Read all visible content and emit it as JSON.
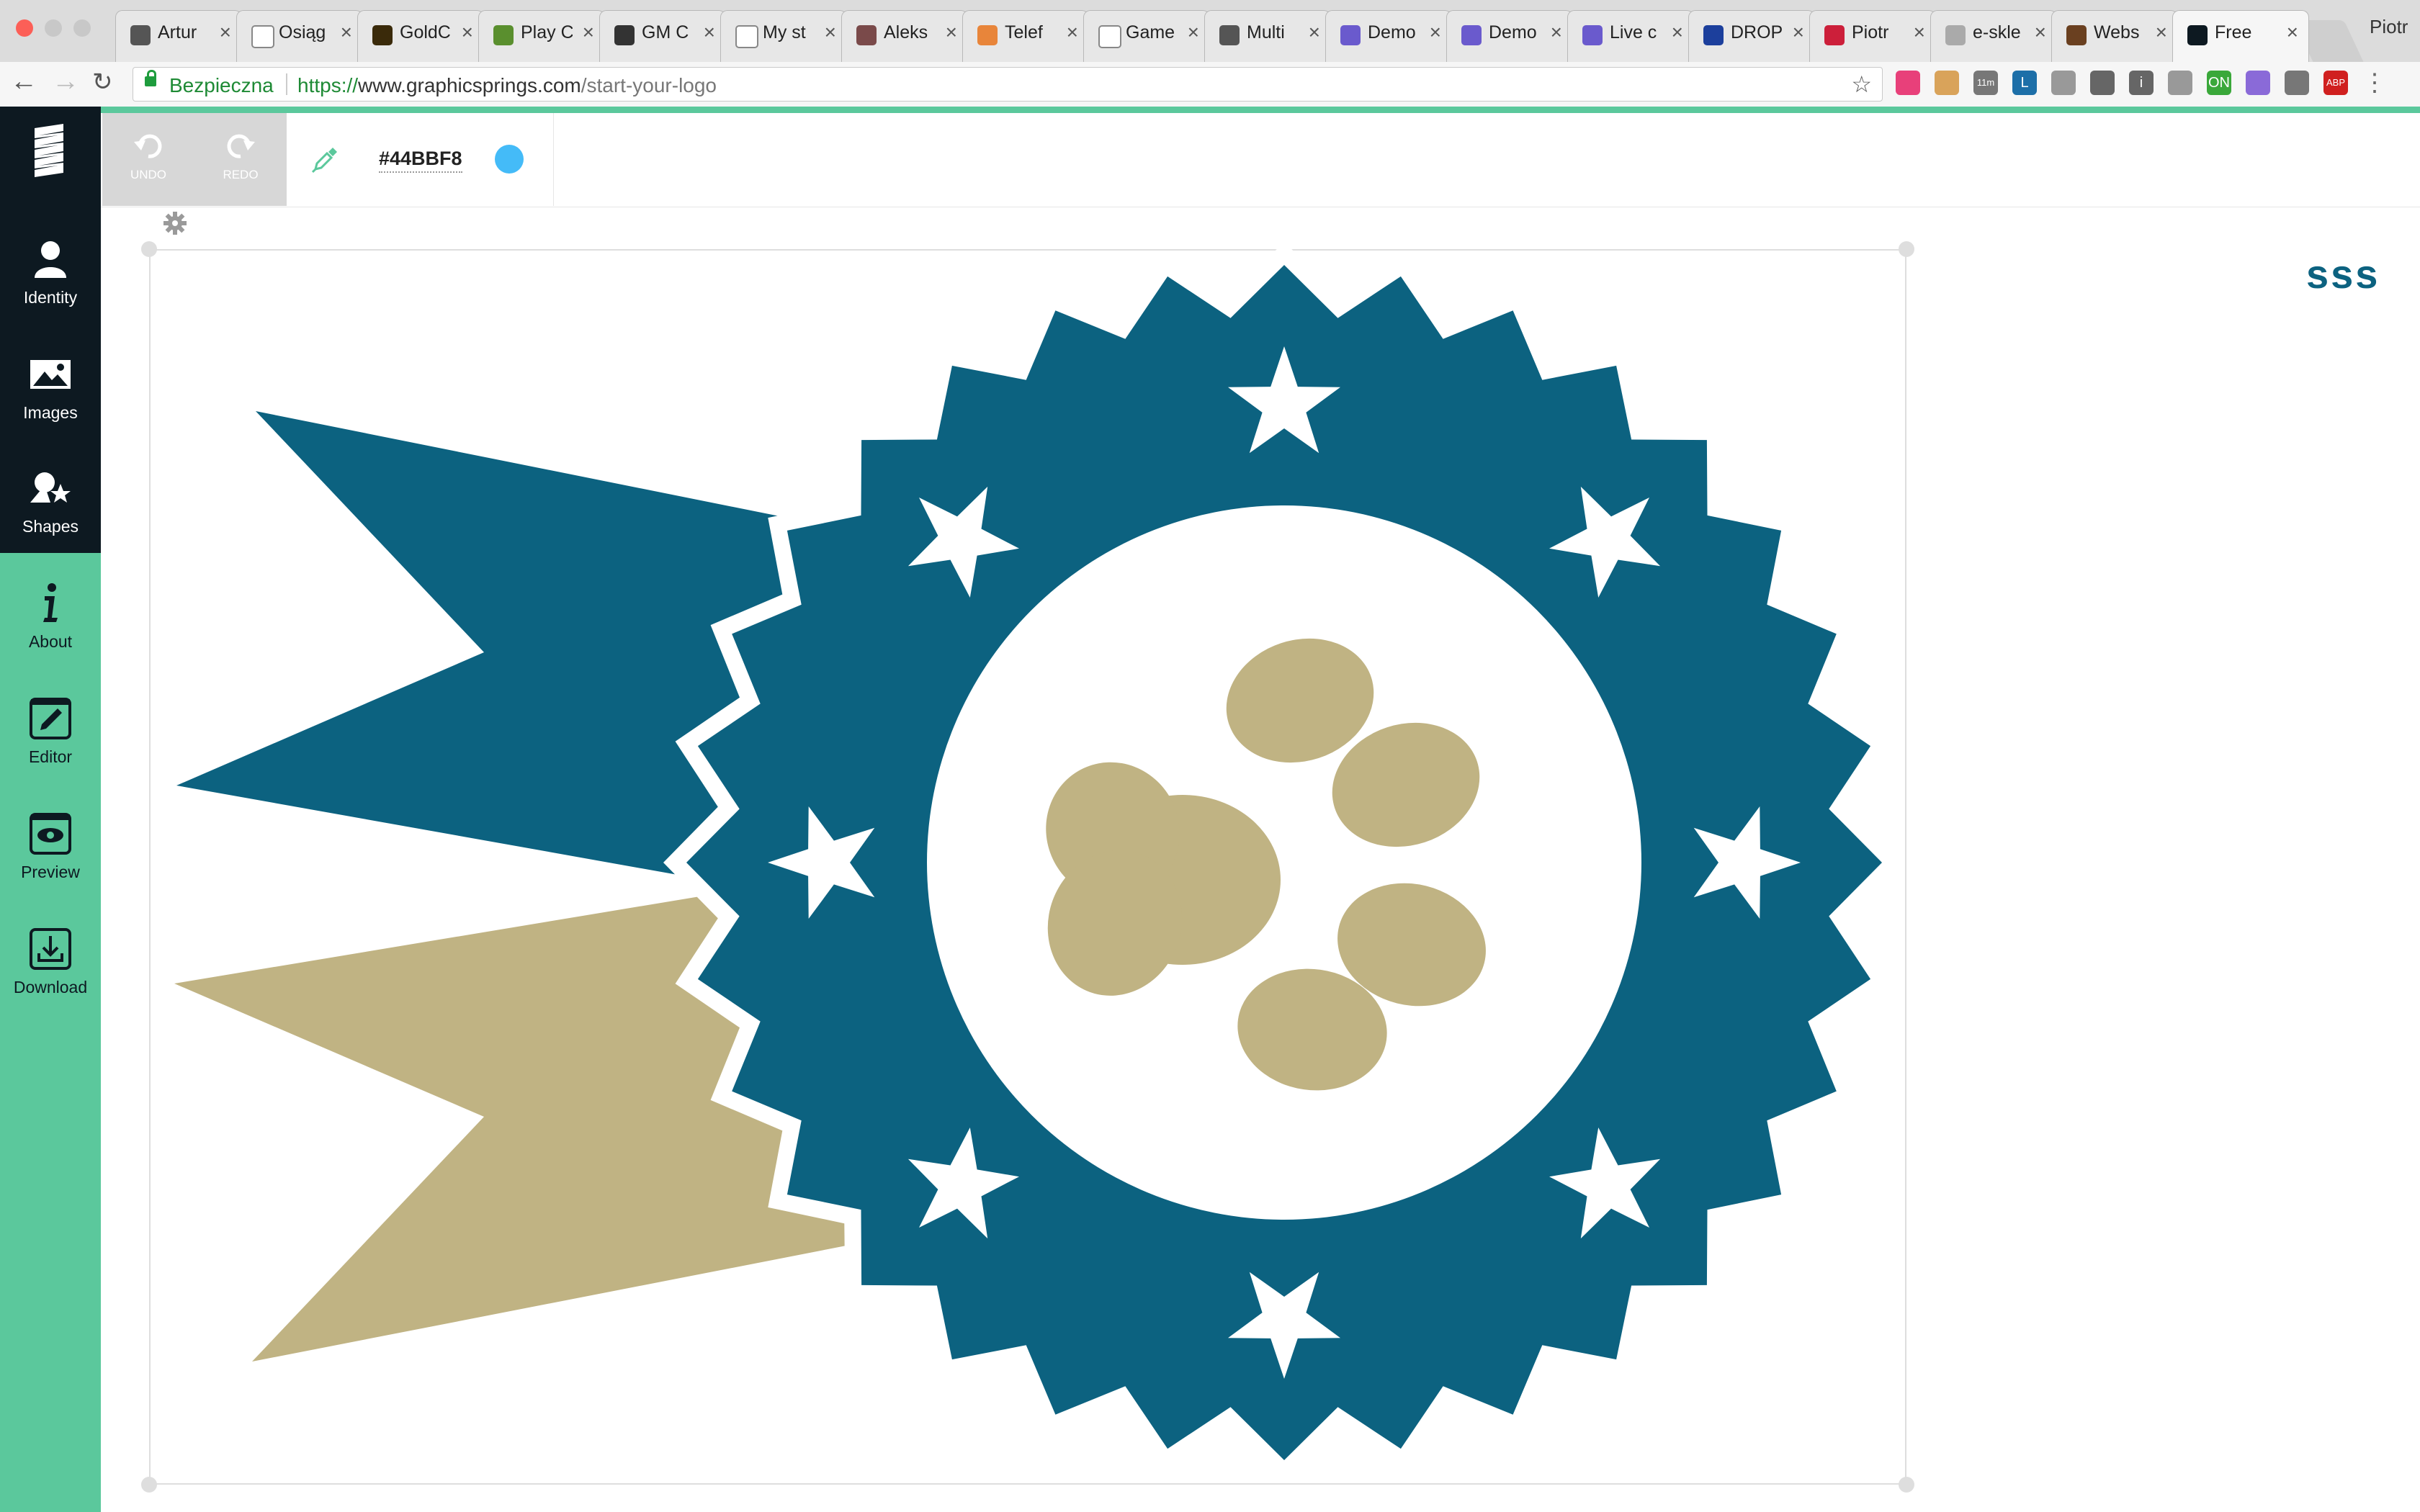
{
  "browser": {
    "tabs": [
      {
        "title": "Artur",
        "favicon": "shield-crest-icon",
        "color": "#555555"
      },
      {
        "title": "Osiąg",
        "favicon": "page-icon",
        "color": "#ffffff"
      },
      {
        "title": "GoldC",
        "favicon": "chess-icon",
        "color": "#3a2a0a"
      },
      {
        "title": "Play C",
        "favicon": "pawn-icon",
        "color": "#5a8f2e"
      },
      {
        "title": "GM C",
        "favicon": "gm-icon",
        "color": "#333333"
      },
      {
        "title": "My st",
        "favicon": "page-icon",
        "color": "#ffffff"
      },
      {
        "title": "Aleks",
        "favicon": "chess-pieces-icon",
        "color": "#7a4a4a"
      },
      {
        "title": "Telef",
        "favicon": "globe-icon",
        "color": "#e8853a"
      },
      {
        "title": "Game",
        "favicon": "page-icon",
        "color": "#ffffff"
      },
      {
        "title": "Multi",
        "favicon": "wordpress-icon",
        "color": "#555555"
      },
      {
        "title": "Demo",
        "favicon": "demo-icon",
        "color": "#6a5acd"
      },
      {
        "title": "Demo",
        "favicon": "demo-icon",
        "color": "#6a5acd"
      },
      {
        "title": "Live c",
        "favicon": "demo-icon",
        "color": "#6a5acd"
      },
      {
        "title": "DROP",
        "favicon": "eu-flag-icon",
        "color": "#1c3f9c"
      },
      {
        "title": "Piotr",
        "favicon": "eagle-icon",
        "color": "#cc1f3a"
      },
      {
        "title": "e-skle",
        "favicon": "shop-icon",
        "color": "#aaaaaa"
      },
      {
        "title": "Webs",
        "favicon": "portrait-icon",
        "color": "#6a4020"
      },
      {
        "title": "Free",
        "favicon": "graphicsprings-icon",
        "color": "#0d1921",
        "active": true
      }
    ],
    "tab_close": "×",
    "profile_name": "Piotr",
    "secure_label": "Bezpieczna",
    "url_protocol": "https://",
    "url_host": "www.graphicsprings.com",
    "url_path": "/start-your-logo",
    "extensions": [
      {
        "name": "stairs-extension-icon",
        "color": "#e8407a",
        "text": ""
      },
      {
        "name": "hammer-extension-icon",
        "color": "#d9a35a",
        "text": ""
      },
      {
        "name": "timer-extension-icon",
        "color": "#777777",
        "text": "11m"
      },
      {
        "name": "linkedin-extension-icon",
        "color": "#1d6fa8",
        "text": "L"
      },
      {
        "name": "camera-extension-icon",
        "color": "#999999",
        "text": ""
      },
      {
        "name": "refresh-extension-icon",
        "color": "#666666",
        "text": ""
      },
      {
        "name": "info-extension-icon",
        "color": "#666666",
        "text": "i"
      },
      {
        "name": "eye-extension-icon",
        "color": "#999999",
        "text": ""
      },
      {
        "name": "on-extension-icon",
        "color": "#3aa83a",
        "text": "ON"
      },
      {
        "name": "eyedropper-extension-icon",
        "color": "#8a6ad8",
        "text": ""
      },
      {
        "name": "block-extension-icon",
        "color": "#777777",
        "text": ""
      },
      {
        "name": "adblock-extension-icon",
        "color": "#d0201f",
        "text": "ABP"
      },
      {
        "name": "menu-dots-icon",
        "color": "#666666",
        "text": "⋮"
      }
    ]
  },
  "sidebar": {
    "logo": "graphicsprings-logo-icon",
    "items": [
      {
        "label": "Identity",
        "icon": "person-icon"
      },
      {
        "label": "Images",
        "icon": "image-icon"
      },
      {
        "label": "Shapes",
        "icon": "shapes-icon"
      },
      {
        "label": "About",
        "icon": "info-icon"
      },
      {
        "label": "Editor",
        "icon": "edit-icon"
      },
      {
        "label": "Preview",
        "icon": "eye-icon"
      },
      {
        "label": "Download",
        "icon": "download-icon"
      }
    ]
  },
  "editor": {
    "undo_label": "UNDO",
    "redo_label": "REDO",
    "color_hex": "#44BBF8",
    "swatch_color": "#44BBF8",
    "picker_icon": "eyedropper-icon",
    "settings_icon": "gear-icon"
  },
  "logo": {
    "brand_text": "sss",
    "brand_color": "#0c6280",
    "primary_color": "#0c6280",
    "secondary_color": "#c0b383",
    "background": "#ffffff",
    "description_icon": "award-rosette-paw-icon"
  },
  "colors": {
    "accent_green": "#5bc89c",
    "sidebar_dark": "#0d1921"
  }
}
